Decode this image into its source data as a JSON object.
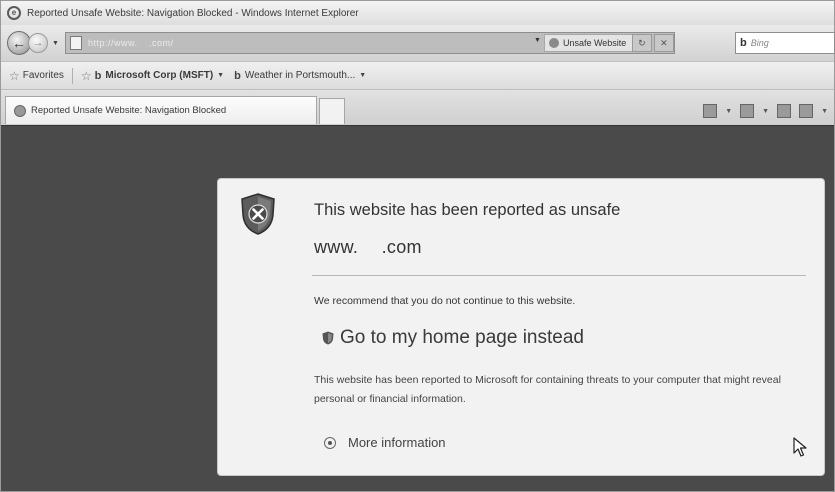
{
  "window": {
    "title": "Reported Unsafe Website: Navigation Blocked - Windows Internet Explorer"
  },
  "navbar": {
    "address_url": "http://www.     .com/",
    "unsafe_label": "Unsafe Website",
    "search_placeholder": "Bing",
    "search_logo": "b"
  },
  "favorites": {
    "label": "Favorites",
    "items": [
      {
        "label": "Microsoft Corp (MSFT)"
      },
      {
        "label": "Weather in Portsmouth..."
      }
    ]
  },
  "tabs": [
    {
      "label": "Reported Unsafe Website: Navigation Blocked"
    }
  ],
  "dialog": {
    "title": "This website has been reported as unsafe",
    "url": "www.      .com",
    "recommend": "We recommend that you do not continue to this website.",
    "home_link": "Go to my home page instead",
    "reported": "This website has been reported to Microsoft for containing threats to your computer that might reveal personal or financial information.",
    "more_info": "More information"
  }
}
